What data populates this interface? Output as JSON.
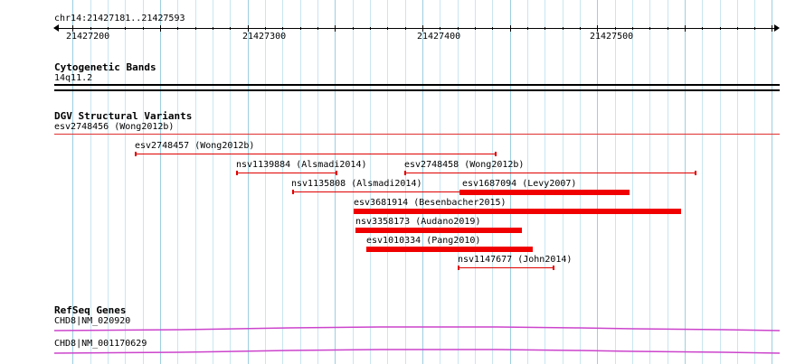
{
  "ruler": {
    "location": "chr14:21427181..21427593",
    "labels": [
      "21427200",
      "21427300",
      "21427400",
      "21427500"
    ]
  },
  "cytoband": {
    "title": "Cytogenetic Bands",
    "band": "14q11.2"
  },
  "dgv": {
    "title": "DGV Structural Variants",
    "top_label": "esv2748456 (Wong2012b)",
    "variants": [
      {
        "label": "esv2748457 (Wong2012b)",
        "style": "thin"
      },
      {
        "label": "nsv1139884 (Alsmadi2014)",
        "style": "thin"
      },
      {
        "label": "esv2748458 (Wong2012b)",
        "style": "thin"
      },
      {
        "label": "nsv1135808 (Alsmadi2014)",
        "style": "thin"
      },
      {
        "label": "esv1687094 (Levy2007)",
        "style": "thick"
      },
      {
        "label": "esv3681914 (Besenbacher2015)",
        "style": "thick"
      },
      {
        "label": "nsv3358173 (Audano2019)",
        "style": "thick"
      },
      {
        "label": "esv1010334 (Pang2010)",
        "style": "thick"
      },
      {
        "label": "nsv1147677 (John2014)",
        "style": "thin"
      }
    ]
  },
  "refseq": {
    "title": "RefSeq Genes",
    "transcripts": [
      {
        "label": "CHD8|NM_020920"
      },
      {
        "label": "CHD8|NM_001170629"
      }
    ]
  },
  "colors": {
    "grid": "#c8e6f0",
    "variant": "#e00000",
    "gene": "#cc44cc"
  }
}
